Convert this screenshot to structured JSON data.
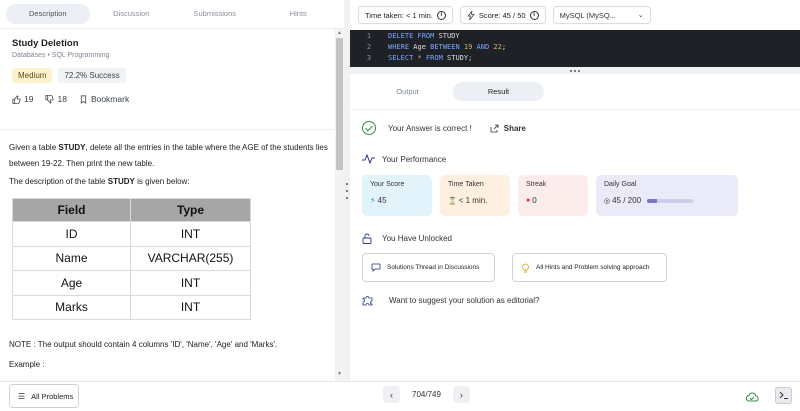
{
  "left": {
    "tabs": [
      "Description",
      "Discussion",
      "Submissions",
      "Hints"
    ],
    "active_tab": "Description",
    "problem_title": "Study Deletion",
    "breadcrumb": "Databases • SQL Programming",
    "difficulty": "Medium",
    "success_rate": "72.2% Success",
    "likes": "19",
    "dislikes": "18",
    "bookmark_label": "Bookmark",
    "desc_line1_pre": "Given a table ",
    "desc_line1_bold": "STUDY",
    "desc_line1_post": ", delete all the entries in the table where the AGE of the students lies between 19-22. Then print the new table.",
    "desc_line2_pre": "The description of the table ",
    "desc_line2_bold": "STUDY",
    "desc_line2_post": " is given below:",
    "table_headers": [
      "Field",
      "Type"
    ],
    "table_rows": [
      [
        "ID",
        "INT"
      ],
      [
        "Name",
        "VARCHAR(255)"
      ],
      [
        "Age",
        "INT"
      ],
      [
        "Marks",
        "INT"
      ]
    ],
    "note": "NOTE : The output should contain 4 columns 'ID', 'Name', 'Age' and 'Marks'.",
    "example_label": "Example :"
  },
  "right": {
    "time_taken": "Time taken: < 1 min.",
    "score": "Score: 45 / 50",
    "language": "MySQL (MySQ...",
    "output_tabs": [
      "Output",
      "Result"
    ],
    "active_output_tab": "Result",
    "correct_msg": "Your Answer is correct !",
    "share_label": "Share",
    "performance_title": "Your Performance",
    "cards": {
      "score_label": "Your Score",
      "score_value": "45",
      "time_label": "Time Taken",
      "time_value": "< 1 min.",
      "streak_label": "Streak",
      "streak_value": "0",
      "goal_label": "Daily Goal",
      "goal_value": "45 / 200",
      "goal_progress": 0.225
    },
    "unlocked_title": "You Have Unlocked",
    "unlock_1": "Solutions Thread in Discussions",
    "unlock_2": "All Hints and Problem solving approach",
    "editorial_prompt": "Want to suggest your solution as editorial?"
  },
  "code": {
    "line_numbers": [
      "1",
      "2",
      "3"
    ]
  },
  "bottom": {
    "all_problems": "All Problems",
    "page": "704/749"
  },
  "colors": {
    "accent_green": "#2f8d46",
    "medium_badge": "#fdf1cf"
  }
}
